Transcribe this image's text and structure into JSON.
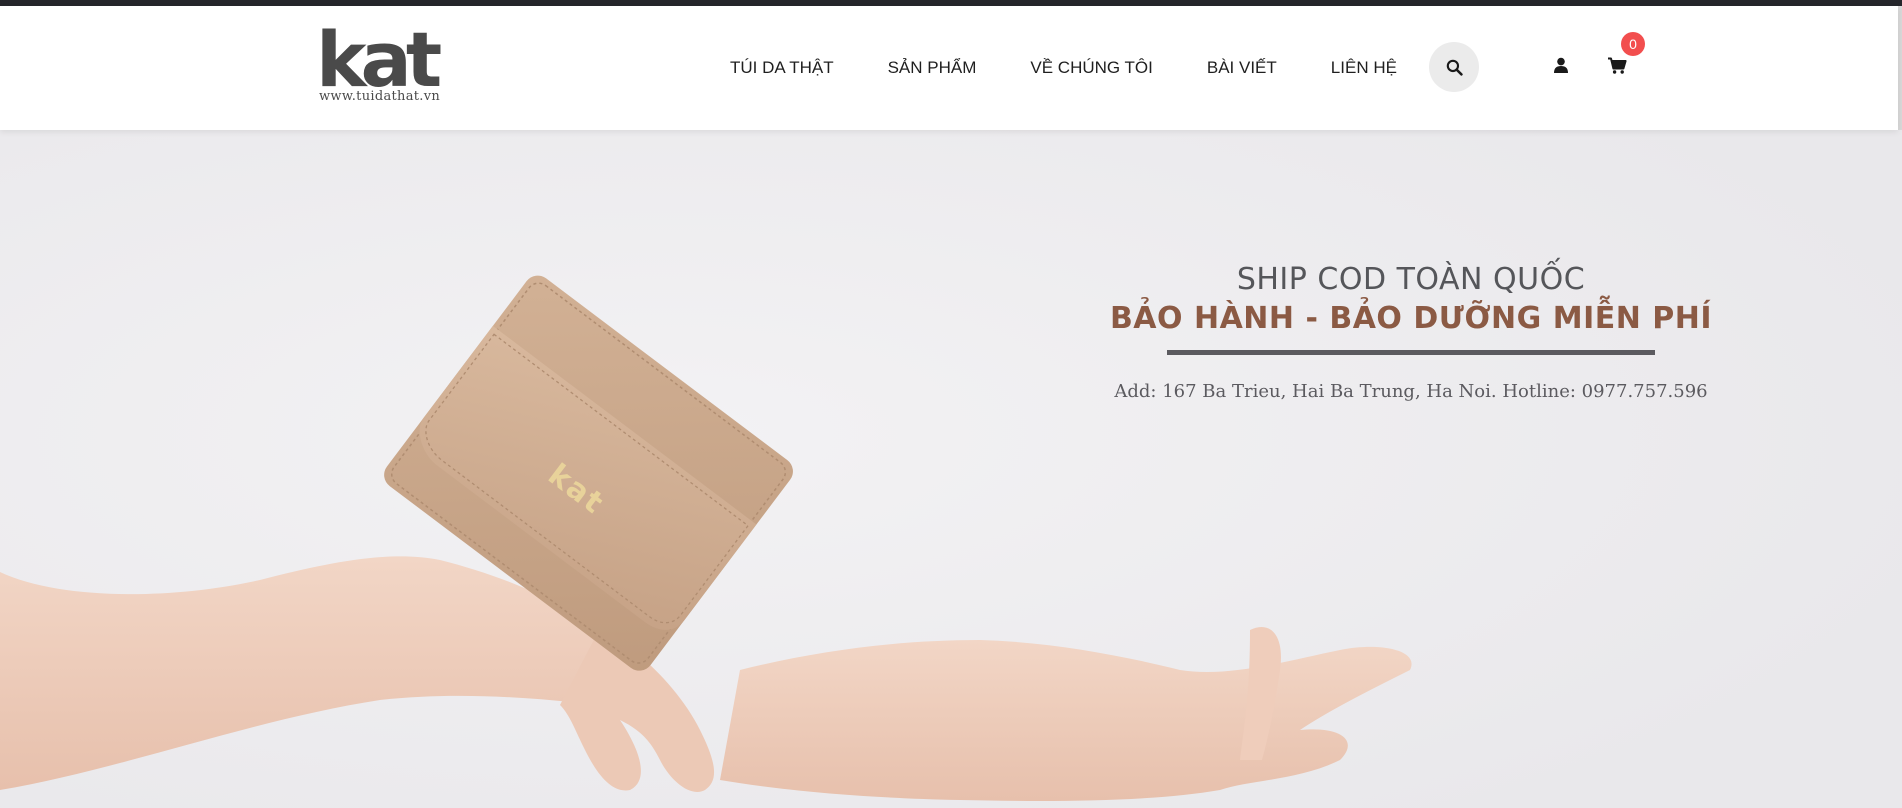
{
  "brand": {
    "logo_text": "kat",
    "logo_url_text": "www.tuidathat.vn"
  },
  "nav": {
    "items": [
      {
        "label": "TÚI DA THẬT"
      },
      {
        "label": "SẢN PHẨM"
      },
      {
        "label": "VỀ CHÚNG TÔI"
      },
      {
        "label": "BÀI VIẾT"
      },
      {
        "label": "LIÊN HỆ"
      }
    ]
  },
  "header_icons": {
    "search": "search-icon",
    "user": "user-icon",
    "cart": "cart-icon",
    "cart_count": "0"
  },
  "hero": {
    "line1": "SHIP COD TOÀN QUỐC",
    "line2": "BẢO HÀNH - BẢO DƯỠNG MIỄN PHÍ",
    "address": "Add: 167 Ba Trieu, Hai Ba Trung, Ha Noi. Hotline: 0977.757.596",
    "wallet_brand": "kat"
  },
  "colors": {
    "topbar": "#25262b",
    "badge": "#f24e4e",
    "accent_brown": "#8b5a44",
    "wallet": "#c9a587"
  }
}
